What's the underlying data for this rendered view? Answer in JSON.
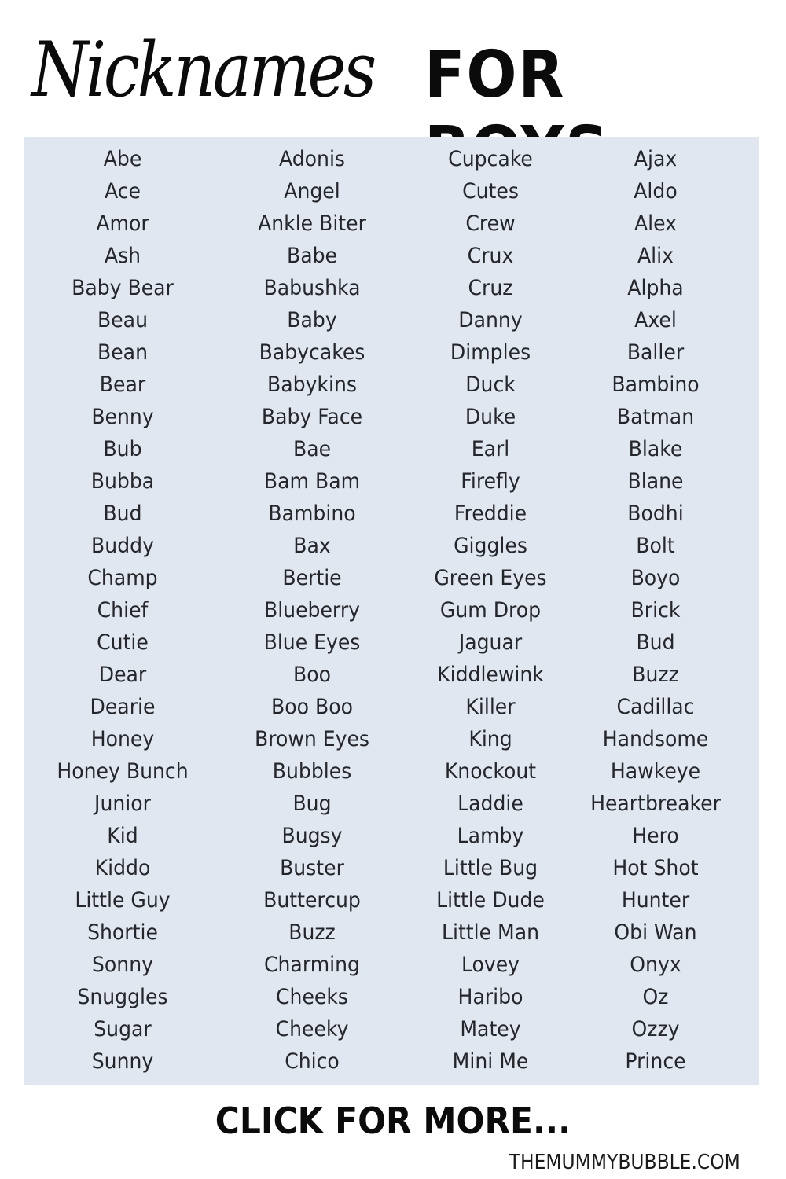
{
  "header": {
    "title_script": "Nicknames",
    "title_bold": "FOR BOYS"
  },
  "panel": {
    "background_color": "#e1e7f1",
    "columns": [
      {
        "names": [
          "Abe",
          "Ace",
          "Amor",
          "Ash",
          "Baby Bear",
          "Beau",
          "Bean",
          "Bear",
          "Benny",
          "Bub",
          "Bubba",
          "Bud",
          "Buddy",
          "Champ",
          "Chief",
          "Cutie",
          "Dear",
          "Dearie",
          "Honey",
          "Honey Bunch",
          "Junior",
          "Kid",
          "Kiddo",
          "Little Guy",
          "Shortie",
          "Sonny",
          "Snuggles",
          "Sugar",
          "Sunny"
        ]
      },
      {
        "names": [
          "Adonis",
          "Angel",
          "Ankle Biter",
          "Babe",
          "Babushka",
          "Baby",
          "Babycakes",
          "Babykins",
          "Baby Face",
          "Bae",
          "Bam Bam",
          "Bambino",
          "Bax",
          "Bertie",
          "Blueberry",
          "Blue Eyes",
          "Boo",
          "Boo Boo",
          "Brown Eyes",
          "Bubbles",
          "Bug",
          "Bugsy",
          "Buster",
          "Buttercup",
          "Buzz",
          "Charming",
          "Cheeks",
          "Cheeky",
          "Chico"
        ]
      },
      {
        "names": [
          "Cupcake",
          "Cutes",
          "Crew",
          "Crux",
          "Cruz",
          "Danny",
          "Dimples",
          "Duck",
          "Duke",
          "Earl",
          "Firefly",
          "Freddie",
          "Giggles",
          "Green Eyes",
          "Gum Drop",
          "Jaguar",
          "Kiddlewink",
          "Killer",
          "King",
          "Knockout",
          "Laddie",
          "Lamby",
          "Little Bug",
          "Little Dude",
          "Little Man",
          "Lovey",
          "Haribo",
          "Matey",
          "Mini Me"
        ]
      },
      {
        "names": [
          "Ajax",
          "Aldo",
          "Alex",
          "Alix",
          "Alpha",
          "Axel",
          "Baller",
          "Bambino",
          "Batman",
          "Blake",
          "Blane",
          "Bodhi",
          "Bolt",
          "Boyo",
          "Brick",
          "Bud",
          "Buzz",
          "Cadillac",
          "Handsome",
          "Hawkeye",
          "Heartbreaker",
          "Hero",
          "Hot Shot",
          "Hunter",
          "Obi Wan",
          "Onyx",
          "Oz",
          "Ozzy",
          "Prince"
        ]
      }
    ]
  },
  "footer": {
    "cta_label": "CLICK FOR MORE...",
    "site_label": "THEMUMMYBUBBLE.COM"
  }
}
